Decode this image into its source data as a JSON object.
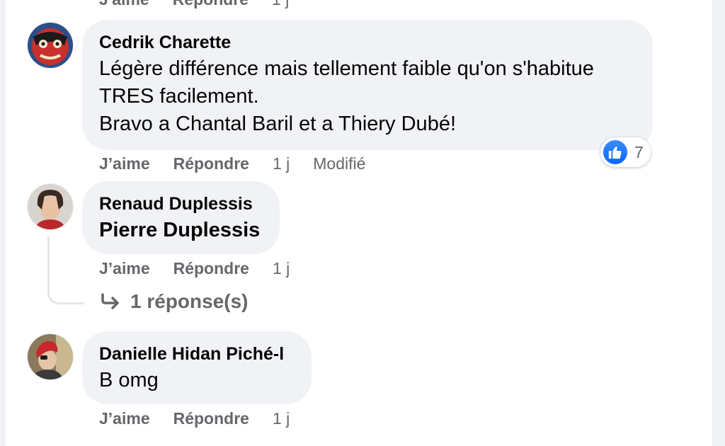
{
  "top_actions": {
    "like": "J'aime",
    "reply": "Répondre",
    "time": "1 j"
  },
  "comments": [
    {
      "author": "Cedrik Charette",
      "text": "Légère différence mais tellement faible qu'on s'habitue\nTRES facilement.\nBravo a Chantal Baril et a Thiery Dubé!",
      "actions": {
        "like": "J’aime",
        "reply": "Répondre",
        "time": "1 j",
        "edited": "Modifié"
      },
      "reactions": {
        "icon": "thumbs-up-icon",
        "count": "7"
      }
    },
    {
      "author": "Renaud Duplessis",
      "text": "Pierre Duplessis",
      "actions": {
        "like": "J’aime",
        "reply": "Répondre",
        "time": "1 j"
      },
      "replies_label": "1 réponse(s)"
    },
    {
      "author": "Danielle Hidan Piché-l",
      "text": "B omg",
      "actions": {
        "like": "J’aime",
        "reply": "Répondre",
        "time": "1 j"
      }
    }
  ],
  "colors": {
    "bubble": "#f0f2f5",
    "meta": "#65676b",
    "like_blue": "#0866ff"
  }
}
